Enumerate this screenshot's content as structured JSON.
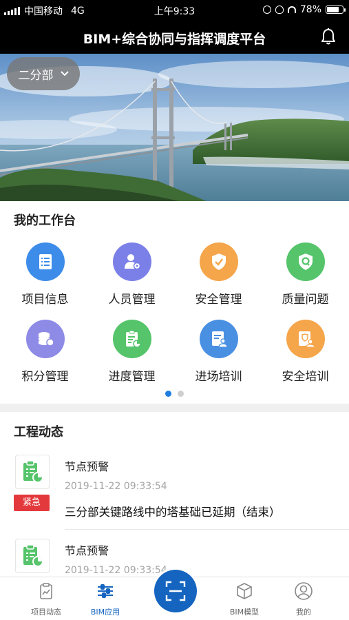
{
  "status_bar": {
    "carrier": "中国移动",
    "network": "4G",
    "time": "上午9:33",
    "battery": "78%",
    "battery_level": 0.78
  },
  "header": {
    "title": "BIM+综合协同与指挥调度平台",
    "bell_icon": "bell-icon"
  },
  "banner": {
    "department_selector": "二分部"
  },
  "workbench": {
    "title": "我的工作台",
    "items": [
      {
        "label": "项目信息",
        "icon": "list-icon",
        "color": "#3d8ce9"
      },
      {
        "label": "人员管理",
        "icon": "user-gear-icon",
        "color": "#7b80e8"
      },
      {
        "label": "安全管理",
        "icon": "shield-check-icon",
        "color": "#f5a54a"
      },
      {
        "label": "质量问题",
        "icon": "shield-q-icon",
        "color": "#55c46a"
      },
      {
        "label": "积分管理",
        "icon": "coin-stack-icon",
        "color": "#8d8be6"
      },
      {
        "label": "进度管理",
        "icon": "clipboard-chart-icon",
        "color": "#55c46a"
      },
      {
        "label": "进场培训",
        "icon": "doc-person-icon",
        "color": "#4a90e2"
      },
      {
        "label": "安全培训",
        "icon": "doc-shield-person-icon",
        "color": "#f5a54a"
      }
    ],
    "page_indicator": {
      "pages": 2,
      "active": 0,
      "active_color": "#1e7ee0",
      "inactive_color": "#cfcfcf"
    }
  },
  "news": {
    "title": "工程动态",
    "items": [
      {
        "title": "节点预警",
        "time": "2019-11-22 09:33:54",
        "tag": "紧急",
        "content": "三分部关键路线中的塔基础已延期（结束）"
      },
      {
        "title": "节点预警",
        "time": "2019-11-22 09:33:54"
      }
    ]
  },
  "tabbar": {
    "items": [
      {
        "label": "项目动态",
        "icon": "clipboard-icon",
        "active": false
      },
      {
        "label": "BIM应用",
        "icon": "sliders-icon",
        "active": true
      },
      {
        "label": "",
        "icon": "scan-icon",
        "active": false
      },
      {
        "label": "BIM模型",
        "icon": "cube-icon",
        "active": false
      },
      {
        "label": "我的",
        "icon": "profile-icon",
        "active": false
      }
    ],
    "active_color": "#1565c0"
  }
}
